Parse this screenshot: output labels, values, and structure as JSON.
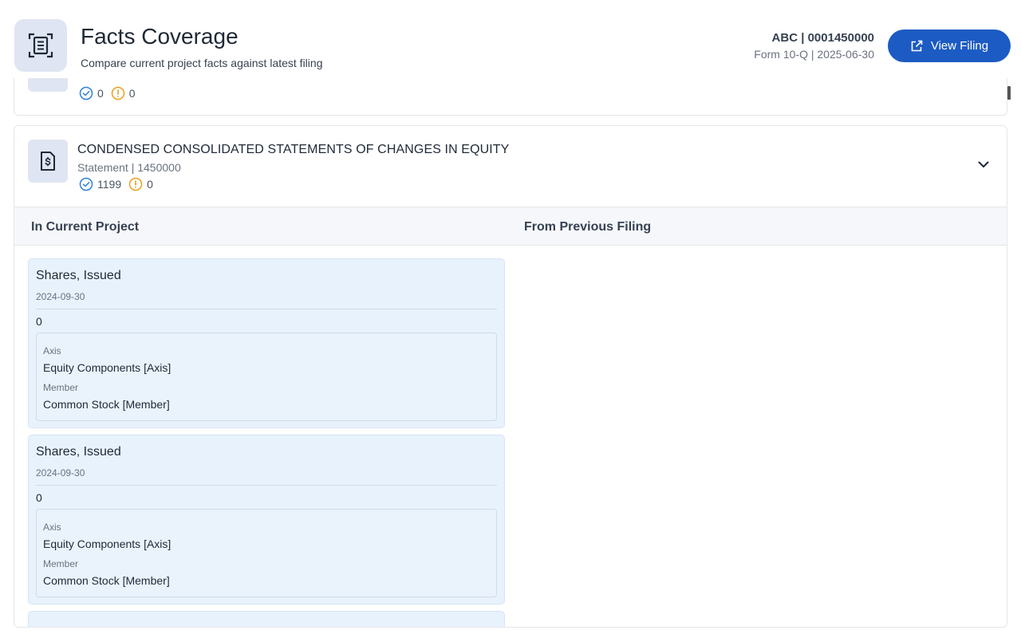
{
  "header": {
    "icon": "document-scan-icon",
    "title": "Facts Coverage",
    "subtitle": "Compare current project facts against latest filing",
    "company": "ABC | 0001450000",
    "form_line": "Form 10-Q | 2025-06-30",
    "view_filing_label": "View Filing",
    "accent_color": "#1c5bc4"
  },
  "previous_section": {
    "verified_count": "0",
    "warning_count": "0"
  },
  "section": {
    "icon": "dollar-document-icon",
    "title": "CONDENSED CONSOLIDATED STATEMENTS OF CHANGES IN EQUITY",
    "meta": "Statement | 1450000",
    "verified_count": "1199",
    "warning_count": "0",
    "expanded": true
  },
  "columns": {
    "left": "In Current Project",
    "right": "From Previous Filing"
  },
  "facts": [
    {
      "name": "Shares, Issued",
      "date": "2024-09-30",
      "value": "0",
      "axis_label": "Axis",
      "axis": "Equity Components [Axis]",
      "member_label": "Member",
      "member": "Common Stock [Member]"
    },
    {
      "name": "Shares, Issued",
      "date": "2024-09-30",
      "value": "0",
      "axis_label": "Axis",
      "axis": "Equity Components [Axis]",
      "member_label": "Member",
      "member": "Common Stock [Member]"
    }
  ]
}
